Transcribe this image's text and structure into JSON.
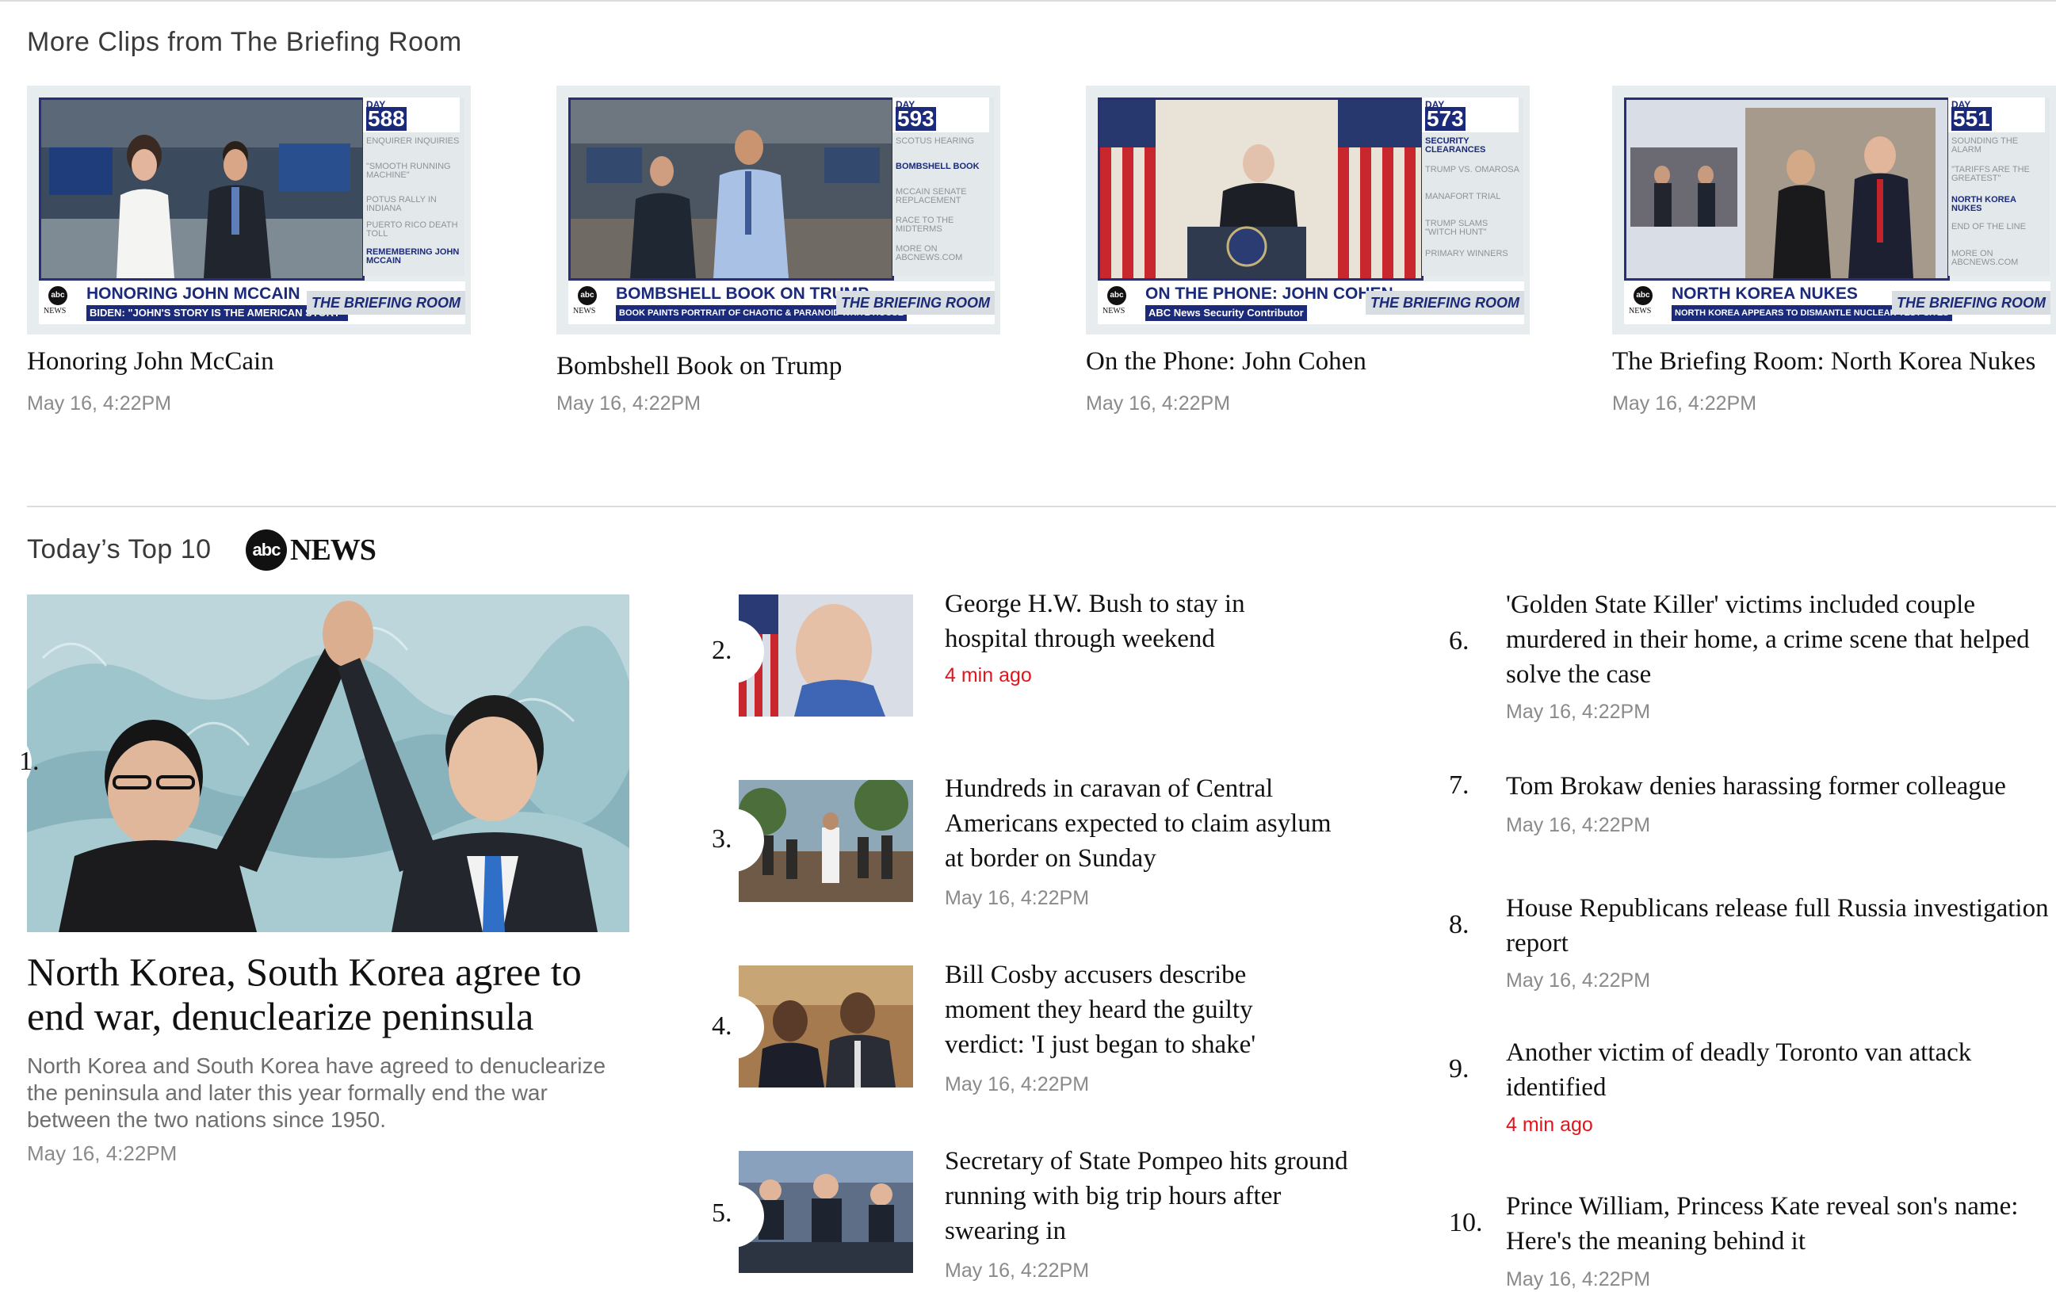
{
  "clips_section": {
    "title": "More Clips from The Briefing Room",
    "items": [
      {
        "title": "Honoring John McCain",
        "meta": "May 16, 4:22PM",
        "thumb": {
          "day_label": "DAY",
          "day_number": "588",
          "side_items": [
            {
              "text": "ENQUIRER INQUIRIES",
              "active": false
            },
            {
              "text": "\"SMOOTH RUNNING MACHINE\"",
              "active": false
            },
            {
              "text": "POTUS RALLY IN INDIANA",
              "active": false
            },
            {
              "text": "PUERTO RICO DEATH TOLL",
              "active": false
            },
            {
              "text": "REMEMBERING JOHN MCCAIN",
              "active": true
            }
          ],
          "headline": "HONORING JOHN MCCAIN",
          "sub": "BIDEN: \"JOHN'S STORY IS THE AMERICAN STORY\"",
          "brand": "THE BRIEFING ROOM"
        }
      },
      {
        "title": "Bombshell Book on Trump",
        "meta": "May 16, 4:22PM",
        "thumb": {
          "day_label": "DAY",
          "day_number": "593",
          "side_items": [
            {
              "text": "SCOTUS HEARING",
              "active": false
            },
            {
              "text": "BOMBSHELL BOOK",
              "active": true
            },
            {
              "text": "MCCAIN SENATE REPLACEMENT",
              "active": false
            },
            {
              "text": "RACE TO THE MIDTERMS",
              "active": false
            },
            {
              "text": "MORE ON ABCNEWS.COM",
              "active": false
            }
          ],
          "headline": "BOMBSHELL BOOK ON TRUMP",
          "sub": "BOOK PAINTS PORTRAIT OF CHAOTIC & PARANOID WHITE HOUSE",
          "brand": "THE BRIEFING ROOM"
        }
      },
      {
        "title": "On the Phone: John Cohen",
        "meta": "May 16, 4:22PM",
        "thumb": {
          "day_label": "DAY",
          "day_number": "573",
          "side_items": [
            {
              "text": "SECURITY CLEARANCES",
              "active": true
            },
            {
              "text": "TRUMP VS. OMAROSA",
              "active": false
            },
            {
              "text": "MANAFORT TRIAL",
              "active": false
            },
            {
              "text": "TRUMP SLAMS \"WITCH HUNT\"",
              "active": false
            },
            {
              "text": "PRIMARY WINNERS",
              "active": false
            }
          ],
          "headline": "ON THE PHONE: JOHN COHEN",
          "sub": "ABC News Security Contributor",
          "brand": "THE BRIEFING ROOM"
        }
      },
      {
        "title": "The Briefing Room: North Korea Nukes",
        "meta": "May 16, 4:22PM",
        "thumb": {
          "day_label": "DAY",
          "day_number": "551",
          "side_items": [
            {
              "text": "SOUNDING THE ALARM",
              "active": false
            },
            {
              "text": "\"TARIFFS ARE THE GREATEST\"",
              "active": false
            },
            {
              "text": "NORTH KOREA NUKES",
              "active": true
            },
            {
              "text": "END OF THE LINE",
              "active": false
            },
            {
              "text": "MORE ON ABCNEWS.COM",
              "active": false
            }
          ],
          "headline": "NORTH KOREA NUKES",
          "sub": "NORTH KOREA APPEARS TO DISMANTLE NUCLEAR TEST SITES",
          "brand": "THE BRIEFING ROOM"
        }
      }
    ]
  },
  "top10": {
    "title": "Today’s Top 10",
    "logo_abc": "abc",
    "logo_news": "NEWS",
    "hero": {
      "rank": "1.",
      "title": "North Korea, South Korea agree to end war, denuclearize peninsula",
      "description": "North Korea and South Korea have agreed to denuclearize the peninsula and later this year formally end the war between the two nations since 1950.",
      "meta": "May 16, 4:22PM"
    },
    "stories": [
      {
        "rank": "2.",
        "title": "George H.W. Bush to stay in hospital through weekend",
        "meta": "4 min ago",
        "fresh": true
      },
      {
        "rank": "3.",
        "title": "Hundreds in caravan of Central Americans expected to claim asylum at border on Sunday",
        "meta": "May 16, 4:22PM",
        "fresh": false
      },
      {
        "rank": "4.",
        "title": "Bill Cosby accusers describe moment they heard the guilty verdict: 'I just began to shake'",
        "meta": "May 16, 4:22PM",
        "fresh": false
      },
      {
        "rank": "5.",
        "title": "Secretary of State Pompeo hits ground running with big trip hours after swearing in",
        "meta": "May 16, 4:22PM",
        "fresh": false
      },
      {
        "rank": "6.",
        "title": "'Golden State Killer' victims included couple murdered in their home, a crime scene that helped solve the case",
        "meta": "May 16, 4:22PM",
        "fresh": false
      },
      {
        "rank": "7.",
        "title": "Tom Brokaw denies harassing former colleague",
        "meta": "May 16, 4:22PM",
        "fresh": false
      },
      {
        "rank": "8.",
        "title": "House Republicans release full Russia investigation report",
        "meta": "May 16, 4:22PM",
        "fresh": false
      },
      {
        "rank": "9.",
        "title": "Another victim of deadly Toronto van attack identified",
        "meta": "4 min ago",
        "fresh": true
      },
      {
        "rank": "10.",
        "title": "Prince William, Princess Kate reveal son's name: Here's the meaning behind it",
        "meta": "May 16, 4:22PM",
        "fresh": false
      }
    ]
  },
  "colors": {
    "accent_red": "#e4141b",
    "briefing_navy": "#1b2a7a",
    "meta_gray": "#8a8a8a"
  }
}
